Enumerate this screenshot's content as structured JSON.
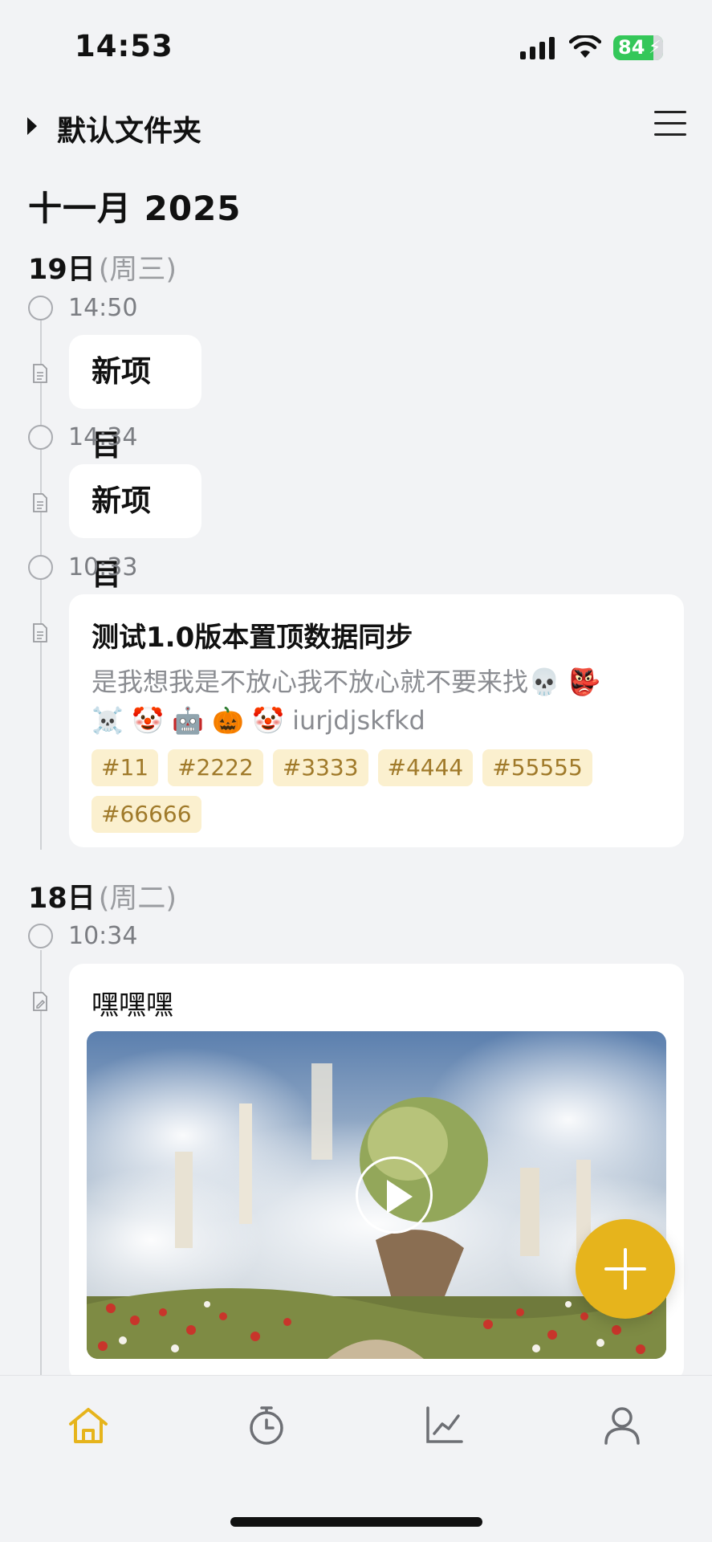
{
  "status_bar": {
    "time": "14:53",
    "battery": "84"
  },
  "header": {
    "folder_name": "默认文件夹"
  },
  "month_title": "十一月 2025",
  "days": [
    {
      "day": "19日",
      "weekday": "(周三)",
      "entries": [
        {
          "time": "14:50",
          "title": "新项目"
        },
        {
          "time": "14:34",
          "title": "新项目"
        },
        {
          "time": "10:33",
          "title": "测试1.0版本置顶数据同步",
          "body_line1": "是我想我是不放心我不放心就不要来找💀 👺",
          "body_line2": "☠️ 🤡 🤖 🎃 🤡 iurjdjskfkd",
          "tags": [
            "#11",
            "#2222",
            "#3333",
            "#4444",
            "#55555",
            "#66666"
          ]
        }
      ]
    },
    {
      "day": "18日",
      "weekday": "(周二)",
      "entries": [
        {
          "time": "10:34",
          "title": "嘿嘿嘿"
        }
      ]
    }
  ],
  "icons": {
    "tabs": [
      "home-icon",
      "timer-icon",
      "chart-icon",
      "profile-icon"
    ],
    "accent": "#e6b41c"
  }
}
